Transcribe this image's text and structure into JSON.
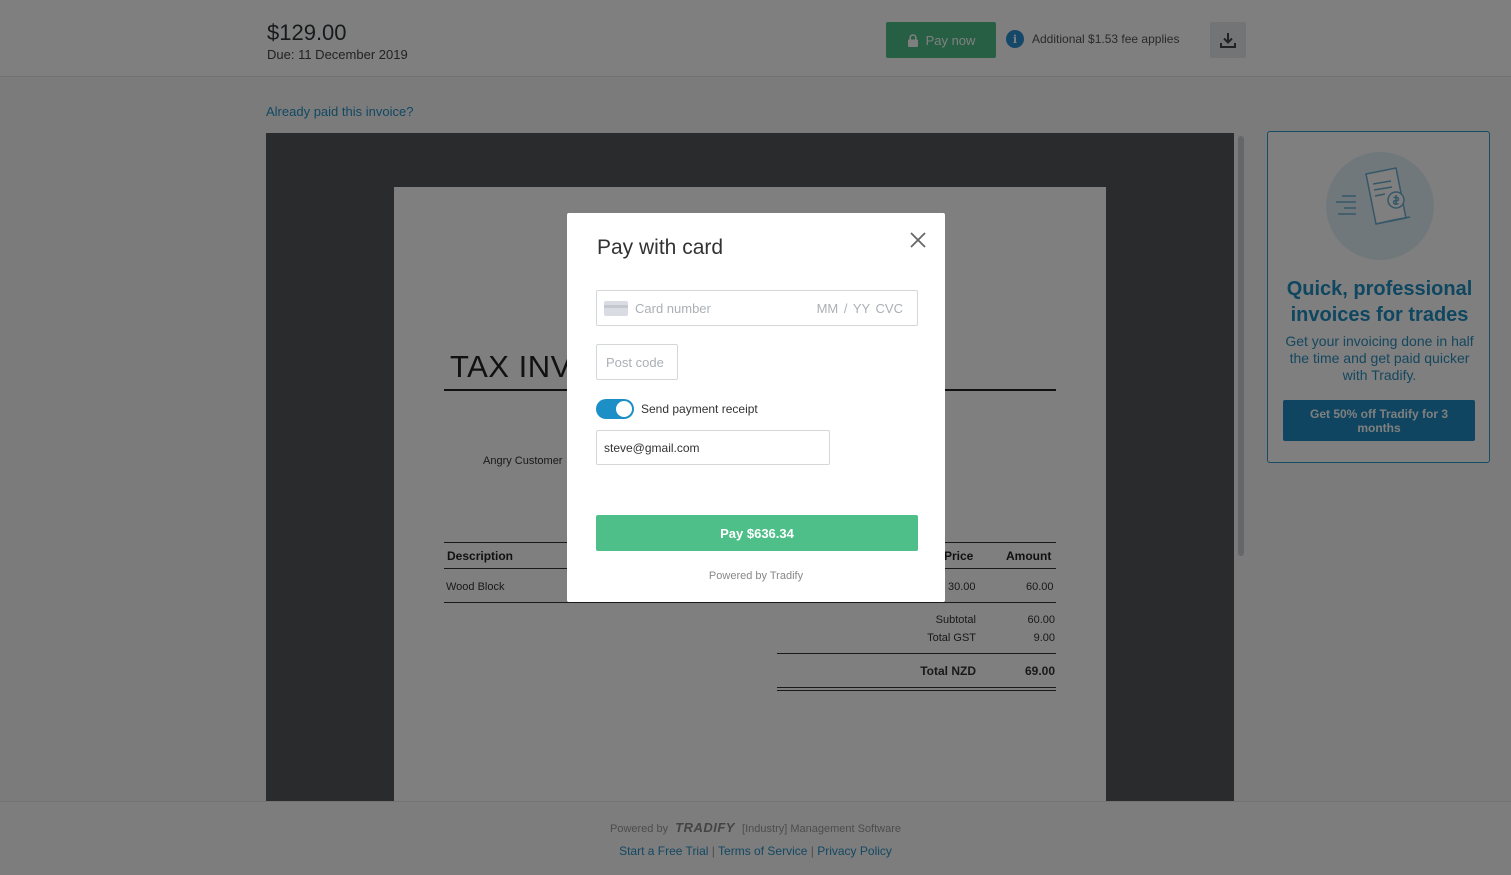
{
  "header": {
    "amount": "$129.00",
    "due": "Due: 11 December 2019",
    "pay_now_label": "Pay now",
    "fee_text": "Additional $1.53 fee applies"
  },
  "already_paid_link": "Already paid this invoice?",
  "invoice": {
    "title": "TAX INV",
    "customer": "Angry Customer",
    "columns": {
      "description": "Description",
      "price": "Price",
      "amount": "Amount"
    },
    "rows": [
      {
        "description": "Wood Block",
        "price": "30.00",
        "amount": "60.00"
      }
    ],
    "subtotal_label": "Subtotal",
    "subtotal": "60.00",
    "gst_label": "Total GST",
    "gst": "9.00",
    "total_label": "Total NZD",
    "total": "69.00"
  },
  "promo": {
    "title": "Quick, professional invoices for trades",
    "body": "Get your invoicing done in half the time and get paid quicker with Tradify.",
    "button_label": "Get 50% off Tradify for 3 months"
  },
  "footer": {
    "powered_prefix": "Powered by",
    "brand": "TRADIFY",
    "powered_suffix": "[Industry] Management Software",
    "links": [
      "Start a Free Trial",
      "Terms of Service",
      "Privacy Policy"
    ],
    "separator": "|"
  },
  "modal": {
    "title": "Pay with card",
    "card_number_placeholder": "Card number",
    "card_expiry_cvc_placeholder": "MM / YY  CVC",
    "postcode_placeholder": "Post code",
    "send_receipt_label": "Send payment receipt",
    "send_receipt_enabled": true,
    "email_value": "steve@gmail.com",
    "pay_button_label": "Pay $636.34",
    "powered_by": "Powered by Tradify"
  },
  "colors": {
    "green": "#4fbf8a",
    "blue": "#1e8bc0",
    "info_blue": "#2b8fd2",
    "viewer_bg": "#525659"
  },
  "icons": {
    "pay_now": "lock-icon",
    "fee": "info-icon",
    "download": "download-icon",
    "promo": "receipt-dollar-icon",
    "modal_close": "close-icon",
    "card_field": "credit-card-icon"
  }
}
